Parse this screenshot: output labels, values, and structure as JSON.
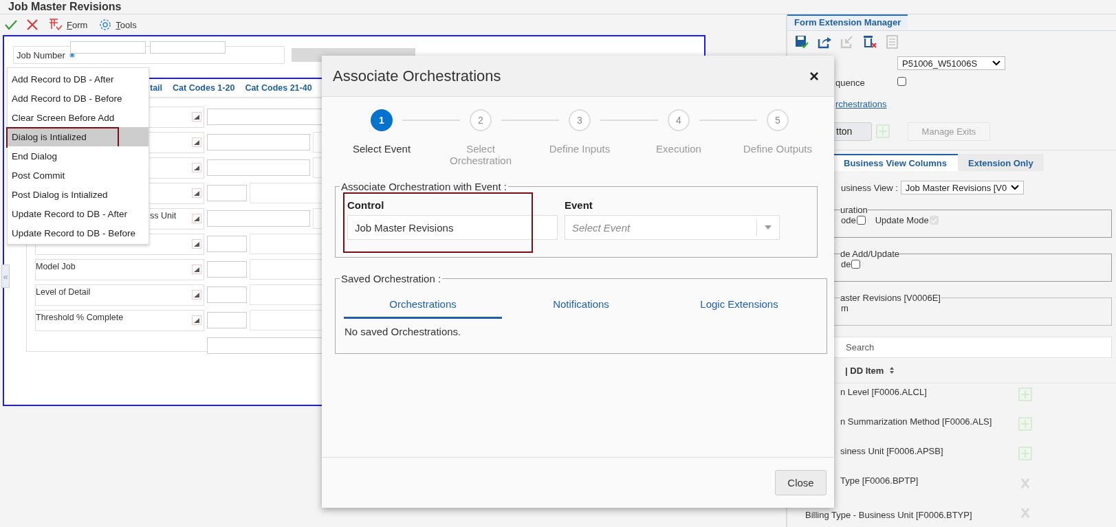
{
  "window": {
    "title": "Job Master Revisions"
  },
  "toolbar": {
    "form_label": "Form",
    "tools_label": "Tools"
  },
  "job_header": {
    "label": "Job Number"
  },
  "form_tabs": [
    {
      "label": "tail"
    },
    {
      "label": "Cat Codes 1-20"
    },
    {
      "label": "Cat Codes 21-40"
    }
  ],
  "form_rows": [
    {
      "kind": "long"
    },
    {
      "kind": "medium"
    },
    {
      "kind": "medium"
    },
    {
      "kind": "short"
    },
    {
      "kind": "medium",
      "covered_label": "ss Unit"
    },
    {
      "kind": "short"
    },
    {
      "kind": "short",
      "label": "Model Job"
    },
    {
      "kind": "short",
      "label": "Level of Detail"
    },
    {
      "kind": "short",
      "label": "Threshold % Complete"
    }
  ],
  "collapse_handle": "«",
  "event_menu": {
    "items": [
      {
        "label": "Add Record to DB - After",
        "selected": false
      },
      {
        "label": "Add Record to DB - Before",
        "selected": false
      },
      {
        "label": "Clear Screen Before Add",
        "selected": false
      },
      {
        "label": "Dialog is Intialized",
        "selected": true
      },
      {
        "label": "End Dialog",
        "selected": false
      },
      {
        "label": "Post Commit",
        "selected": false
      },
      {
        "label": "Post Dialog is Intialized",
        "selected": false
      },
      {
        "label": "Update Record to DB - After",
        "selected": false
      },
      {
        "label": "Update Record to DB - Before",
        "selected": false
      }
    ]
  },
  "modal": {
    "title": "Associate Orchestrations",
    "close": "×",
    "steps": [
      {
        "number": "1",
        "label": "Select Event",
        "selected": true
      },
      {
        "number": "2",
        "label": "Select Orchestration",
        "selected": false
      },
      {
        "number": "3",
        "label": "Define Inputs",
        "selected": false
      },
      {
        "number": "4",
        "label": "Execution",
        "selected": false
      },
      {
        "number": "5",
        "label": "Define Outputs",
        "selected": false
      }
    ],
    "event_group": {
      "legend": "Associate Orchestration with Event :",
      "control_label": "Control",
      "control_value": "Job Master Revisions",
      "event_label": "Event",
      "event_placeholder": "Select Event"
    },
    "saved": {
      "legend": "Saved Orchestration :",
      "tabs": [
        {
          "label": "Orchestrations",
          "selected": true
        },
        {
          "label": "Notifications",
          "selected": false
        },
        {
          "label": "Logic Extensions",
          "selected": false
        }
      ],
      "empty_text": "No saved Orchestrations."
    },
    "close_button": "Close"
  },
  "side_panel": {
    "tab": "Form Extension Manager",
    "form_select": "P51006_W51006S",
    "sequence_label": "quence",
    "sequence_checked": false,
    "orchestrations_link": "rchestrations",
    "button_label": "tton",
    "manage_exits": "Manage Exits",
    "tabs": [
      {
        "label": "Business View Columns",
        "selected": true
      },
      {
        "label": "Extension Only",
        "selected": false
      }
    ],
    "business_view_label": "usiness View :",
    "business_view_select": "Job Master Revisions [V0",
    "configuration": {
      "legend": "uration",
      "options": [
        {
          "label": "ode",
          "checked": false,
          "disabled": false
        },
        {
          "label": "Update Mode",
          "checked": true,
          "disabled": true
        }
      ]
    },
    "add_update": {
      "legend": "de Add/Update",
      "options": [
        {
          "label": "de",
          "checked": false,
          "disabled": false
        }
      ]
    },
    "view_group": {
      "legend": "aster Revisions [V0006E]",
      "text": "m"
    },
    "search_placeholder": "Search",
    "column_header": "| DD Item",
    "columns": [
      {
        "covered_label": "n Level [F0006.ALCL]",
        "kind": "add"
      },
      {
        "covered_label": "n Summarization Method [F0006.ALS]",
        "kind": "add"
      },
      {
        "covered_label": "siness Unit [F0006.APSB]",
        "kind": "add"
      },
      {
        "covered_label": "Type [F0006.BPTP]",
        "kind": "remove"
      },
      {
        "label": "Billing Type - Business Unit [F0006.BTYP]",
        "kind": "remove"
      }
    ]
  }
}
